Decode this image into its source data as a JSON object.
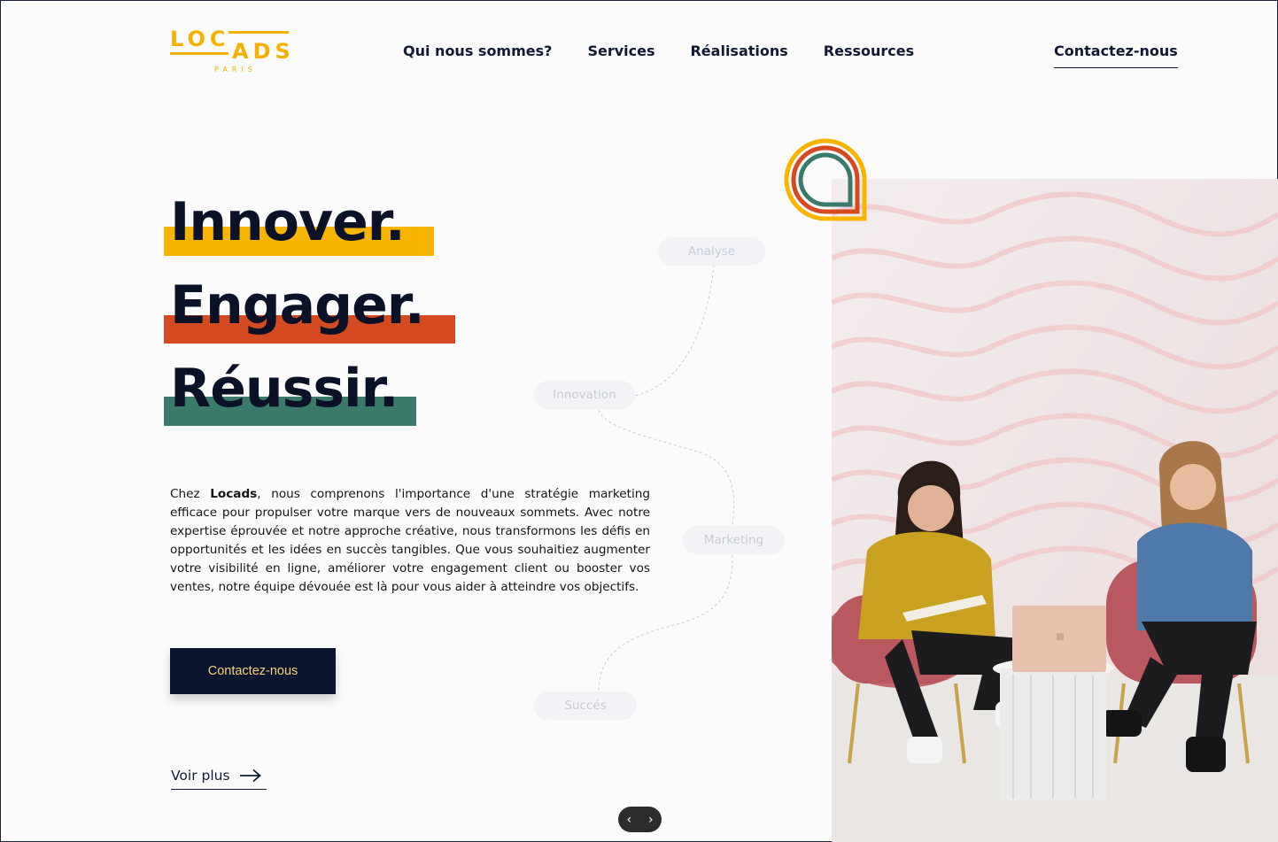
{
  "logo": {
    "line1": "LOC",
    "line2": "ADS",
    "sub": "PARIS"
  },
  "nav": {
    "items": [
      "Qui nous sommes?",
      "Services",
      "Réalisations",
      "Ressources"
    ],
    "contact": "Contactez-nous"
  },
  "hero": {
    "headline1": "Innover.",
    "headline2": "Engager.",
    "headline3": "Réussir.",
    "para_brand": "Locads",
    "para_before": "Chez ",
    "para_after": ", nous comprenons l'importance d'une stratégie marketing efficace pour propulser votre marque vers de nouveaux sommets. Avec notre expertise éprouvée et notre approche créative, nous transformons les défis en opportunités et les idées en succès tangibles. Que vous souhaitiez augmenter votre visibilité en ligne, améliorer votre engagement client ou booster vos ventes, notre équipe dévouée est là pour vous aider à atteindre vos objectifs.",
    "cta_label": "Contactez-nous",
    "more_label": "Voir plus"
  },
  "path_steps": [
    "Analyse",
    "Innovation",
    "Marketing",
    "Succés"
  ],
  "slider": {
    "prev": "‹",
    "next": "›"
  },
  "colors": {
    "navy": "#0c1530",
    "yellow": "#f7b500",
    "orange": "#d64a22",
    "teal": "#3a7a6a",
    "cta_text": "#f6d27a"
  }
}
